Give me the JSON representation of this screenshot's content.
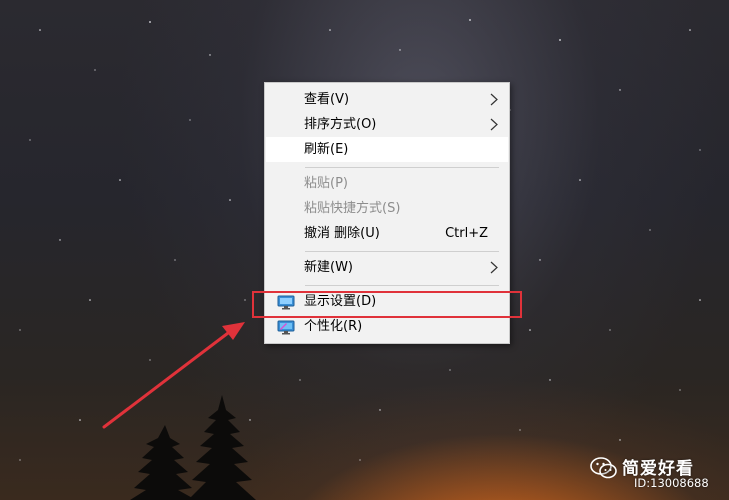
{
  "context_menu": {
    "items": [
      {
        "label": "查看(V)",
        "has_submenu": true
      },
      {
        "label": "排序方式(O)",
        "has_submenu": true
      },
      {
        "label": "刷新(E)",
        "highlighted": true
      },
      {
        "label": "粘贴(P)",
        "disabled": true
      },
      {
        "label": "粘贴快捷方式(S)",
        "disabled": true
      },
      {
        "label": "撤消 删除(U)",
        "shortcut": "Ctrl+Z"
      },
      {
        "label": "新建(W)",
        "has_submenu": true
      },
      {
        "label": "显示设置(D)",
        "icon": "display-settings-icon"
      },
      {
        "label": "个性化(R)",
        "icon": "personalize-icon"
      }
    ]
  },
  "annotation": {
    "box_color": "#e0323a",
    "arrow_color": "#e0323a"
  },
  "watermark": {
    "name": "简爱好看",
    "id": "ID:13008688",
    "icon": "wechat-icon"
  }
}
